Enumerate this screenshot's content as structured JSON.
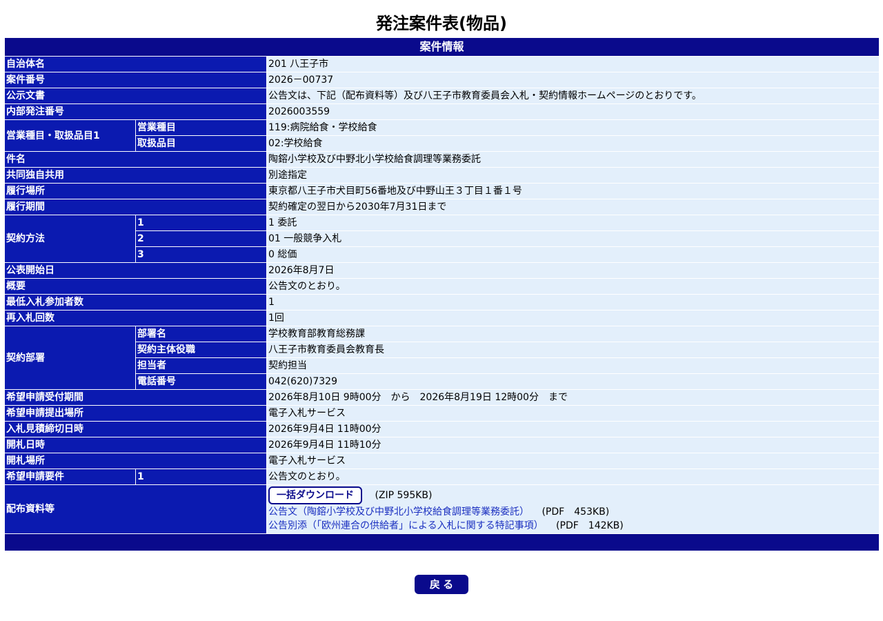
{
  "page_title": "発注案件表(物品)",
  "section_header": "案件情報",
  "rows": {
    "municipality": {
      "label": "自治体名",
      "value": "201 八王子市"
    },
    "case_number": {
      "label": "案件番号",
      "value": "2026－00737"
    },
    "public_notice": {
      "label": "公示文書",
      "value": "公告文は、下記（配布資料等）及び八王子市教育委員会入札・契約情報ホームページのとおりです。"
    },
    "internal_order_number": {
      "label": "内部発注番号",
      "value": "2026003559"
    },
    "business_category": {
      "label": "営業種目・取扱品目1",
      "sub1_label": "営業種目",
      "sub1_value": "119:病院給食・学校給食",
      "sub2_label": "取扱品目",
      "sub2_value": "02:学校給食"
    },
    "subject": {
      "label": "件名",
      "value": "陶鎔小学校及び中野北小学校給食調理等業務委託"
    },
    "joint_use": {
      "label": "共同独自共用",
      "value": "別途指定"
    },
    "place": {
      "label": "履行場所",
      "value": "東京都八王子市犬目町56番地及び中野山王３丁目１番１号"
    },
    "period": {
      "label": "履行期間",
      "value": "契約確定の翌日から2030年7月31日まで"
    },
    "contract_method": {
      "label": "契約方法",
      "items": [
        {
          "num": "1",
          "value": "1 委託"
        },
        {
          "num": "2",
          "value": "01 一般競争入札"
        },
        {
          "num": "3",
          "value": "0 総価"
        }
      ]
    },
    "publish_date": {
      "label": "公表開始日",
      "value": "2026年8月7日"
    },
    "summary": {
      "label": "概要",
      "value": "公告文のとおり。"
    },
    "min_bidders": {
      "label": "最低入札参加者数",
      "value": "1"
    },
    "rebid_count": {
      "label": "再入札回数",
      "value": "1回"
    },
    "department": {
      "label": "契約部署",
      "items": [
        {
          "sub": "部署名",
          "value": "学校教育部教育総務課"
        },
        {
          "sub": "契約主体役職",
          "value": "八王子市教育委員会教育長"
        },
        {
          "sub": "担当者",
          "value": "契約担当"
        },
        {
          "sub": "電話番号",
          "value": "042(620)7329"
        }
      ]
    },
    "application_period": {
      "label": "希望申請受付期間",
      "value": "2026年8月10日 9時00分　から　2026年8月19日 12時00分　まで"
    },
    "application_place": {
      "label": "希望申請提出場所",
      "value": "電子入札サービス"
    },
    "bid_deadline": {
      "label": "入札見積締切日時",
      "value": "2026年9月4日 11時00分"
    },
    "opening_date": {
      "label": "開札日時",
      "value": "2026年9月4日 11時10分"
    },
    "opening_place": {
      "label": "開札場所",
      "value": "電子入札サービス"
    },
    "application_requirements": {
      "label": "希望申請要件",
      "num": "1",
      "value": "公告文のとおり。"
    },
    "documents": {
      "label": "配布資料等",
      "bulk_download_label": "一括ダウンロード",
      "bulk_download_meta": "(ZIP 595KB)",
      "files": [
        {
          "name": "公告文（陶鎔小学校及び中野北小学校給食調理等業務委託）",
          "meta": "(PDF　453KB)"
        },
        {
          "name": "公告別添（「欧州連合の供給者」による入札に関する特記事項）",
          "meta": "(PDF　142KB)"
        }
      ]
    }
  },
  "back_button_label": "戻 る"
}
